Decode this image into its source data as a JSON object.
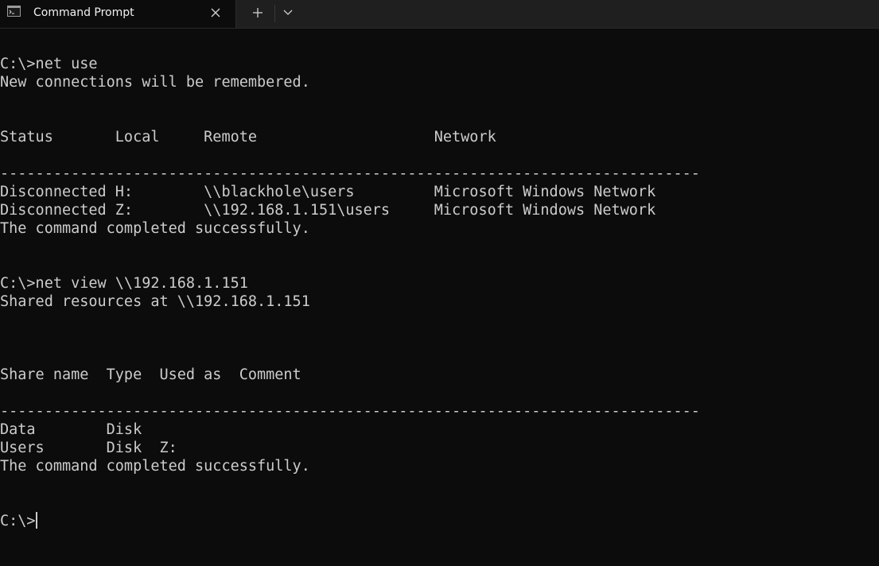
{
  "tab": {
    "title": "Command Prompt",
    "icon": "cmd-icon",
    "close_icon": "close-icon"
  },
  "toolbar": {
    "new_tab_icon": "plus-icon",
    "dropdown_icon": "chevron-down-icon"
  },
  "terminal": {
    "lines": [
      "",
      "C:\\>net use",
      "New connections will be remembered.",
      "",
      "",
      "Status       Local     Remote                    Network",
      "",
      "-------------------------------------------------------------------------------",
      "Disconnected H:        \\\\blackhole\\users         Microsoft Windows Network",
      "Disconnected Z:        \\\\192.168.1.151\\users     Microsoft Windows Network",
      "The command completed successfully.",
      "",
      "",
      "C:\\>net view \\\\192.168.1.151",
      "Shared resources at \\\\192.168.1.151",
      "",
      "",
      "",
      "Share name  Type  Used as  Comment",
      "",
      "-------------------------------------------------------------------------------",
      "Data        Disk",
      "Users       Disk  Z:",
      "The command completed successfully.",
      "",
      "",
      "C:\\>"
    ]
  },
  "colors": {
    "background": "#0c0c0c",
    "titlebar": "#1f1f1f",
    "text": "#cccccc"
  }
}
